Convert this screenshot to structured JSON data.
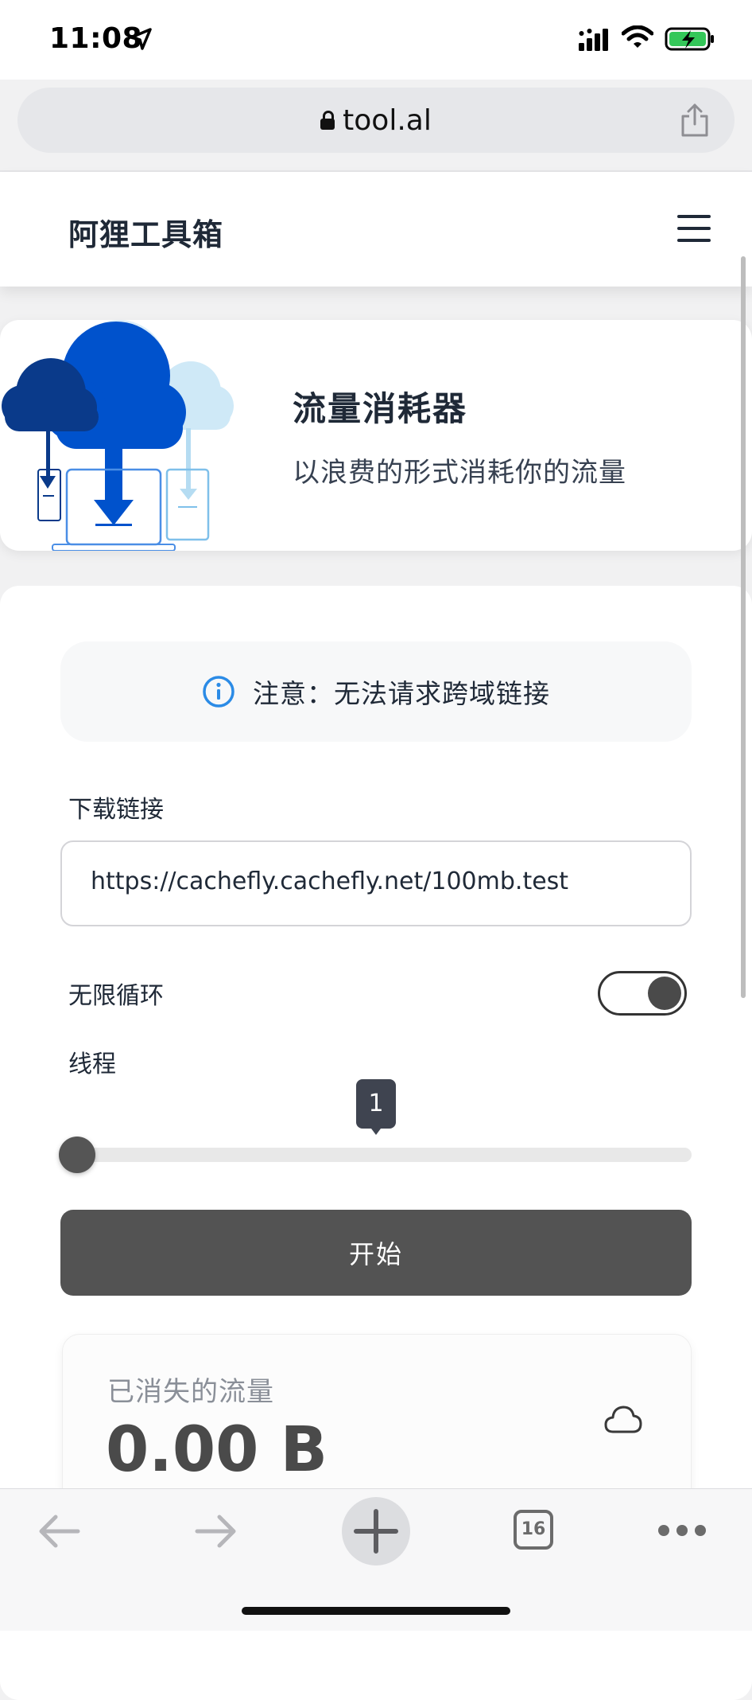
{
  "status_bar": {
    "time": "11:08"
  },
  "browser": {
    "url": "tool.al",
    "tab_count": "16"
  },
  "site": {
    "title": "阿狸工具箱"
  },
  "hero": {
    "title": "流量消耗器",
    "subtitle": "以浪费的形式消耗你的流量"
  },
  "form": {
    "notice": "注意：无法请求跨域链接",
    "url_label": "下载链接",
    "url_value": "https://cachefly.cachefly.net/100mb.test",
    "loop_label": "无限循环",
    "loop_enabled": true,
    "threads_label": "线程",
    "threads_value": "1",
    "start_label": "开始"
  },
  "stats": {
    "consumed_label": "已消失的流量",
    "consumed_value": "0.00 B"
  },
  "colors": {
    "accent_dark": "#535353",
    "info_blue": "#2b8be6",
    "cloud_blue": "#0052cc"
  }
}
